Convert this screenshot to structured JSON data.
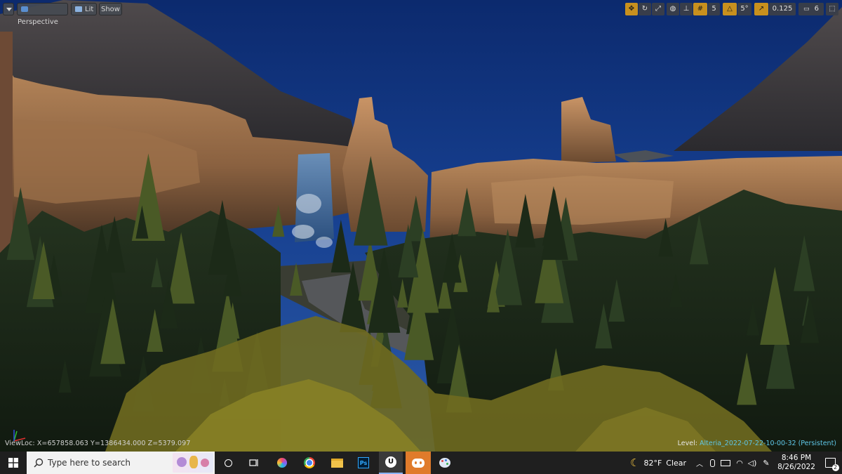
{
  "viewport": {
    "toolbar_left": {
      "menu_icon": "chevron-down-icon",
      "perspective_label": "Perspective",
      "lit_label": "Lit",
      "show_label": "Show"
    },
    "toolbar_right": {
      "grid_snap_value": "5",
      "rotation_snap_value": "5°",
      "scale_snap_value": "0.125",
      "camera_speed_value": "6"
    },
    "viewloc_text": "ViewLoc: X=657858.063 Y=1386434.000 Z=5379.097",
    "level_label": "Level:",
    "level_name": "Alteria_2022-07-22-10-00-32 (Persistent)",
    "accent_colors": {
      "snap_active": "#c8901e",
      "level_name": "#5fc7e8"
    }
  },
  "taskbar": {
    "search_placeholder": "Type here to search",
    "apps": [
      "task-view",
      "creative-cloud",
      "chrome",
      "file-explorer",
      "photoshop",
      "unreal-engine",
      "discord",
      "paint"
    ],
    "weather_temp": "82°F",
    "weather_condition": "Clear",
    "time": "8:46 PM",
    "date": "8/26/2022",
    "notification_count": "2"
  }
}
